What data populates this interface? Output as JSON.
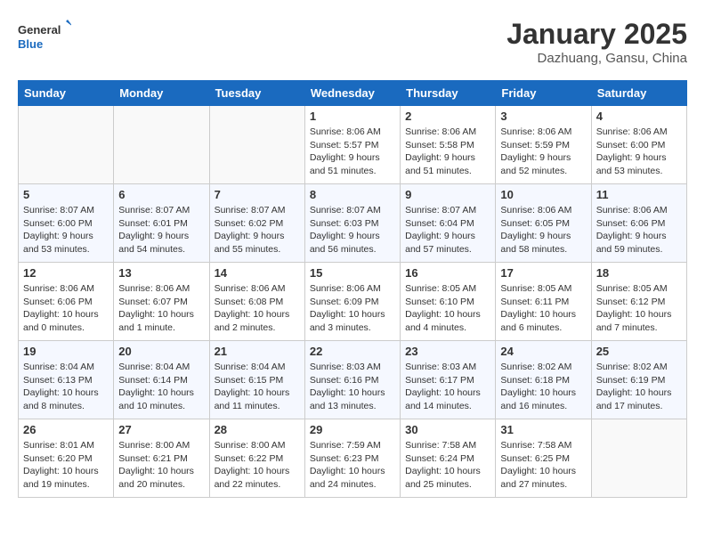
{
  "header": {
    "logo_line1": "General",
    "logo_line2": "Blue",
    "month": "January 2025",
    "location": "Dazhuang, Gansu, China"
  },
  "days_of_week": [
    "Sunday",
    "Monday",
    "Tuesday",
    "Wednesday",
    "Thursday",
    "Friday",
    "Saturday"
  ],
  "weeks": [
    [
      {
        "day": "",
        "info": ""
      },
      {
        "day": "",
        "info": ""
      },
      {
        "day": "",
        "info": ""
      },
      {
        "day": "1",
        "info": "Sunrise: 8:06 AM\nSunset: 5:57 PM\nDaylight: 9 hours and 51 minutes."
      },
      {
        "day": "2",
        "info": "Sunrise: 8:06 AM\nSunset: 5:58 PM\nDaylight: 9 hours and 51 minutes."
      },
      {
        "day": "3",
        "info": "Sunrise: 8:06 AM\nSunset: 5:59 PM\nDaylight: 9 hours and 52 minutes."
      },
      {
        "day": "4",
        "info": "Sunrise: 8:06 AM\nSunset: 6:00 PM\nDaylight: 9 hours and 53 minutes."
      }
    ],
    [
      {
        "day": "5",
        "info": "Sunrise: 8:07 AM\nSunset: 6:00 PM\nDaylight: 9 hours and 53 minutes."
      },
      {
        "day": "6",
        "info": "Sunrise: 8:07 AM\nSunset: 6:01 PM\nDaylight: 9 hours and 54 minutes."
      },
      {
        "day": "7",
        "info": "Sunrise: 8:07 AM\nSunset: 6:02 PM\nDaylight: 9 hours and 55 minutes."
      },
      {
        "day": "8",
        "info": "Sunrise: 8:07 AM\nSunset: 6:03 PM\nDaylight: 9 hours and 56 minutes."
      },
      {
        "day": "9",
        "info": "Sunrise: 8:07 AM\nSunset: 6:04 PM\nDaylight: 9 hours and 57 minutes."
      },
      {
        "day": "10",
        "info": "Sunrise: 8:06 AM\nSunset: 6:05 PM\nDaylight: 9 hours and 58 minutes."
      },
      {
        "day": "11",
        "info": "Sunrise: 8:06 AM\nSunset: 6:06 PM\nDaylight: 9 hours and 59 minutes."
      }
    ],
    [
      {
        "day": "12",
        "info": "Sunrise: 8:06 AM\nSunset: 6:06 PM\nDaylight: 10 hours and 0 minutes."
      },
      {
        "day": "13",
        "info": "Sunrise: 8:06 AM\nSunset: 6:07 PM\nDaylight: 10 hours and 1 minute."
      },
      {
        "day": "14",
        "info": "Sunrise: 8:06 AM\nSunset: 6:08 PM\nDaylight: 10 hours and 2 minutes."
      },
      {
        "day": "15",
        "info": "Sunrise: 8:06 AM\nSunset: 6:09 PM\nDaylight: 10 hours and 3 minutes."
      },
      {
        "day": "16",
        "info": "Sunrise: 8:05 AM\nSunset: 6:10 PM\nDaylight: 10 hours and 4 minutes."
      },
      {
        "day": "17",
        "info": "Sunrise: 8:05 AM\nSunset: 6:11 PM\nDaylight: 10 hours and 6 minutes."
      },
      {
        "day": "18",
        "info": "Sunrise: 8:05 AM\nSunset: 6:12 PM\nDaylight: 10 hours and 7 minutes."
      }
    ],
    [
      {
        "day": "19",
        "info": "Sunrise: 8:04 AM\nSunset: 6:13 PM\nDaylight: 10 hours and 8 minutes."
      },
      {
        "day": "20",
        "info": "Sunrise: 8:04 AM\nSunset: 6:14 PM\nDaylight: 10 hours and 10 minutes."
      },
      {
        "day": "21",
        "info": "Sunrise: 8:04 AM\nSunset: 6:15 PM\nDaylight: 10 hours and 11 minutes."
      },
      {
        "day": "22",
        "info": "Sunrise: 8:03 AM\nSunset: 6:16 PM\nDaylight: 10 hours and 13 minutes."
      },
      {
        "day": "23",
        "info": "Sunrise: 8:03 AM\nSunset: 6:17 PM\nDaylight: 10 hours and 14 minutes."
      },
      {
        "day": "24",
        "info": "Sunrise: 8:02 AM\nSunset: 6:18 PM\nDaylight: 10 hours and 16 minutes."
      },
      {
        "day": "25",
        "info": "Sunrise: 8:02 AM\nSunset: 6:19 PM\nDaylight: 10 hours and 17 minutes."
      }
    ],
    [
      {
        "day": "26",
        "info": "Sunrise: 8:01 AM\nSunset: 6:20 PM\nDaylight: 10 hours and 19 minutes."
      },
      {
        "day": "27",
        "info": "Sunrise: 8:00 AM\nSunset: 6:21 PM\nDaylight: 10 hours and 20 minutes."
      },
      {
        "day": "28",
        "info": "Sunrise: 8:00 AM\nSunset: 6:22 PM\nDaylight: 10 hours and 22 minutes."
      },
      {
        "day": "29",
        "info": "Sunrise: 7:59 AM\nSunset: 6:23 PM\nDaylight: 10 hours and 24 minutes."
      },
      {
        "day": "30",
        "info": "Sunrise: 7:58 AM\nSunset: 6:24 PM\nDaylight: 10 hours and 25 minutes."
      },
      {
        "day": "31",
        "info": "Sunrise: 7:58 AM\nSunset: 6:25 PM\nDaylight: 10 hours and 27 minutes."
      },
      {
        "day": "",
        "info": ""
      }
    ]
  ]
}
